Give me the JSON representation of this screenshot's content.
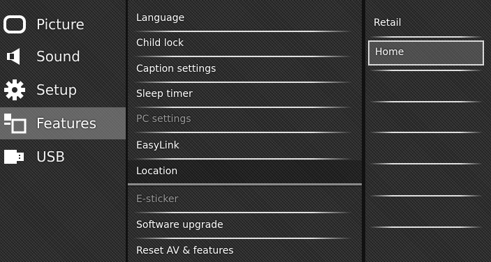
{
  "categories": [
    {
      "label": "Picture",
      "icon": "picture-icon"
    },
    {
      "label": "Sound",
      "icon": "sound-icon"
    },
    {
      "label": "Setup",
      "icon": "setup-gear-icon"
    },
    {
      "label": "Features",
      "icon": "features-icon"
    },
    {
      "label": "USB",
      "icon": "usb-icon"
    }
  ],
  "selected_category": "Features",
  "submenu": [
    {
      "label": "Language",
      "enabled": true
    },
    {
      "label": "Child lock",
      "enabled": true
    },
    {
      "label": "Caption settings",
      "enabled": true
    },
    {
      "label": "Sleep timer",
      "enabled": true
    },
    {
      "label": "PC settings",
      "enabled": false
    },
    {
      "label": "EasyLink",
      "enabled": true
    },
    {
      "label": "Location",
      "enabled": true
    },
    {
      "label": "E-sticker",
      "enabled": false
    },
    {
      "label": "Software upgrade",
      "enabled": true
    },
    {
      "label": "Reset AV & features",
      "enabled": true
    }
  ],
  "current_submenu_item": "Location",
  "options": [
    {
      "label": "Retail"
    },
    {
      "label": "Home"
    }
  ],
  "highlighted_option": "Home"
}
